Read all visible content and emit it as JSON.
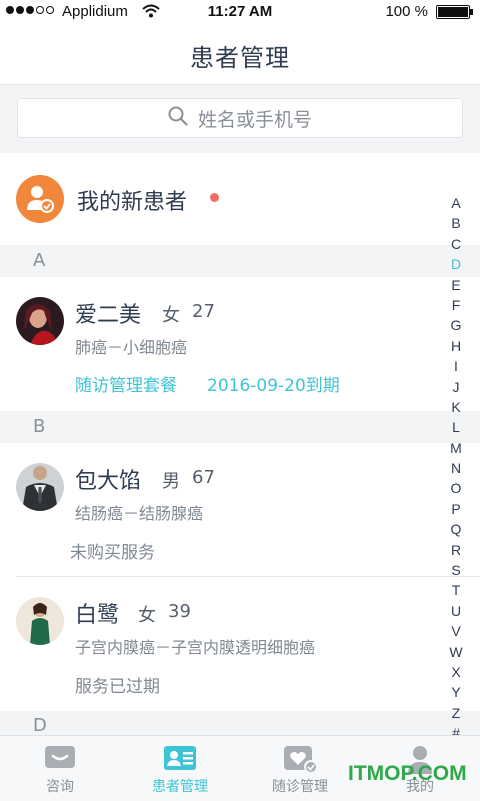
{
  "status_bar": {
    "carrier": "Applidium",
    "time": "11:27 AM",
    "battery": "100 %"
  },
  "nav": {
    "title": "患者管理"
  },
  "search": {
    "placeholder": "姓名或手机号"
  },
  "new_patients": {
    "label": "我的新患者"
  },
  "sections": [
    {
      "letter": "A",
      "patients": [
        {
          "name": "爱二美",
          "gender": "女",
          "age": "27",
          "diagnosis": "肺癌－小细胞癌",
          "service": "随访管理套餐",
          "expiry": "2016-09-20到期"
        }
      ]
    },
    {
      "letter": "B",
      "patients": [
        {
          "name": "包大馅",
          "gender": "男",
          "age": "67",
          "diagnosis": "结肠癌－结肠腺癌",
          "service": "未购买服务"
        },
        {
          "name": "白鹭",
          "gender": "女",
          "age": "39",
          "diagnosis": "子宫内膜癌－子宫内膜透明细胞癌",
          "service": "服务已过期"
        }
      ]
    },
    {
      "letter": "D",
      "patients": []
    }
  ],
  "index_letters": [
    "A",
    "B",
    "C",
    "D",
    "E",
    "F",
    "G",
    "H",
    "I",
    "J",
    "K",
    "L",
    "M",
    "N",
    "O",
    "P",
    "Q",
    "R",
    "S",
    "T",
    "U",
    "V",
    "W",
    "X",
    "Y",
    "Z",
    "#"
  ],
  "index_active": "D",
  "tabs": [
    {
      "label": "咨询",
      "icon": "chat-bubble-icon",
      "active": false
    },
    {
      "label": "患者管理",
      "icon": "patient-card-icon",
      "active": true
    },
    {
      "label": "随诊管理",
      "icon": "heart-check-icon",
      "active": false
    },
    {
      "label": "我的",
      "icon": "user-icon",
      "active": false
    }
  ],
  "watermark": "ITMOP.COM",
  "colors": {
    "accent": "#3fc3d6",
    "orange": "#f0873a",
    "badge_red": "#f06a6a",
    "watermark_green": "#2ea84a"
  }
}
